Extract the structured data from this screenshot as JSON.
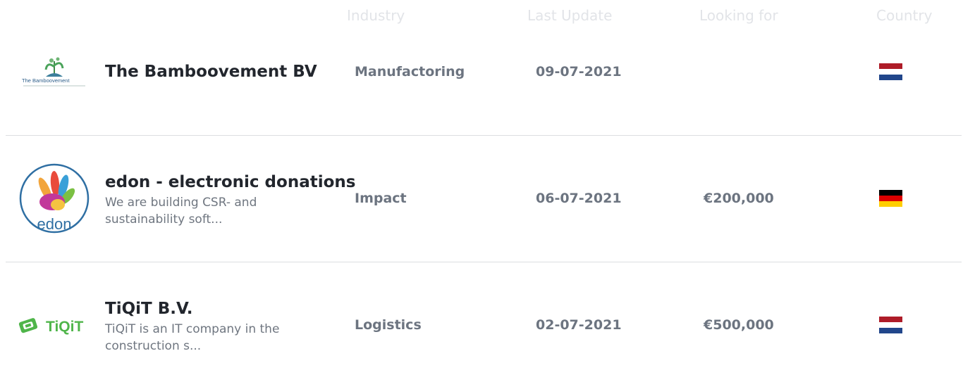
{
  "columns": {
    "industry": "Industry",
    "last_update": "Last Update",
    "looking_for": "Looking for",
    "country": "Country"
  },
  "rows": [
    {
      "name": "The Bamboovement BV",
      "description": "",
      "logo_text": "The Bamboovement",
      "logo_icon": "bamboo-plant-icon",
      "industry": "Manufactoring",
      "last_update": "09-07-2021",
      "looking_for": "",
      "country_flag": "netherlands-flag",
      "flag_colors": [
        "#ae1c28",
        "#ffffff",
        "#21468b"
      ]
    },
    {
      "name": "edon - electronic donations",
      "description": "We are building CSR- and sustainability soft...",
      "logo_text": "edon",
      "logo_icon": "colorful-hands-icon",
      "industry": "Impact",
      "last_update": "06-07-2021",
      "looking_for": "€200,000",
      "country_flag": "germany-flag",
      "flag_colors": [
        "#000000",
        "#dd0000",
        "#ffce00"
      ]
    },
    {
      "name": "TiQiT B.V.",
      "description": "TiQiT is an IT company in the construction s...",
      "logo_text": "TiQiT",
      "logo_icon": "ticket-icon",
      "industry": "Logistics",
      "last_update": "02-07-2021",
      "looking_for": "€500,000",
      "country_flag": "netherlands-flag",
      "flag_colors": [
        "#ae1c28",
        "#ffffff",
        "#21468b"
      ]
    }
  ],
  "colors": {
    "tiqit_green": "#4fb54a",
    "edon_blue": "#2f6fa3"
  }
}
